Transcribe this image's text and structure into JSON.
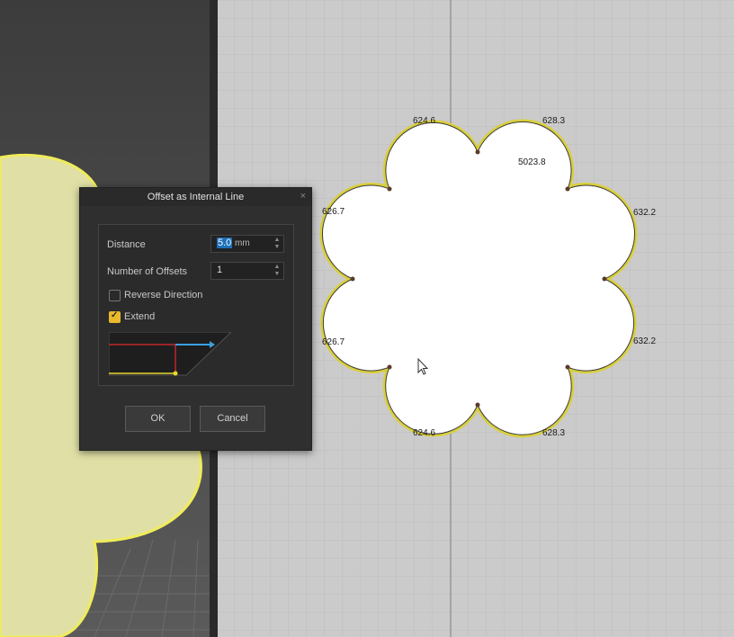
{
  "dialog": {
    "title": "Offset as Internal Line",
    "close_glyph": "×",
    "distance": {
      "label": "Distance",
      "value": "5.0",
      "unit": "mm"
    },
    "offsets": {
      "label": "Number of Offsets",
      "value": "1"
    },
    "reverse_direction": {
      "label": "Reverse Direction",
      "checked": false
    },
    "extend": {
      "label": "Extend",
      "checked": true
    },
    "ok_label": "OK",
    "cancel_label": "Cancel",
    "spin_up": "▲",
    "spin_down": "▼"
  },
  "shape": {
    "area": "5023.8",
    "edge_lengths": {
      "top_left": "624.6",
      "top_right": "628.3",
      "right_upper": "632.2",
      "right_lower": "632.2",
      "bottom_right": "628.3",
      "bottom_left": "624.6",
      "left_lower": "626.7",
      "left_upper": "626.7"
    }
  },
  "colors": {
    "accent_yellow": "#e8d92a",
    "selection_blue": "#1d6fb8",
    "preview_red": "#c0262d",
    "preview_blue": "#3aa0e0"
  }
}
